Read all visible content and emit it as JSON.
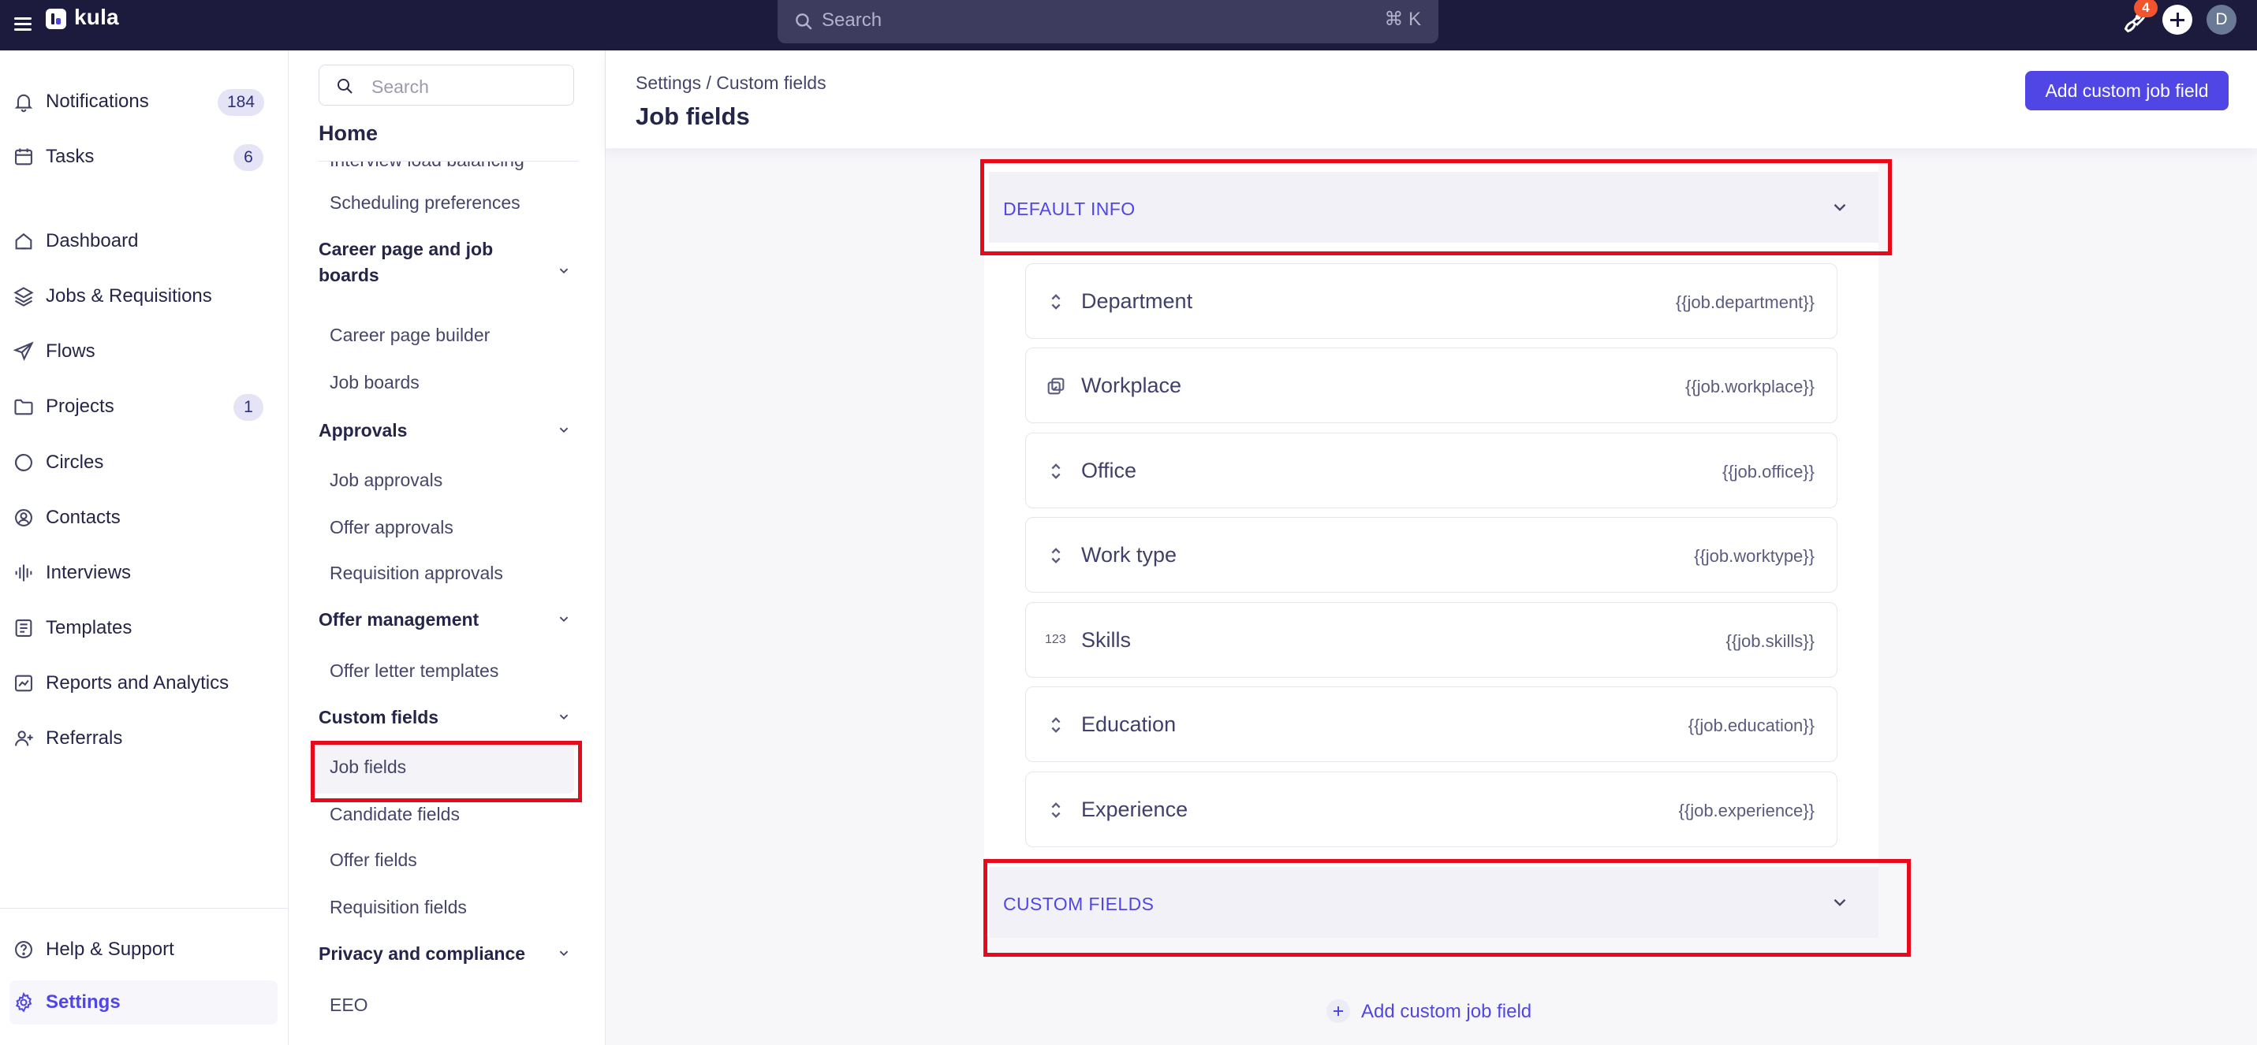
{
  "topbar": {
    "app_name": "kula",
    "search_placeholder": "Search",
    "search_shortcut": "⌘ K",
    "notification_badge": "4",
    "user_initial": "D"
  },
  "leftnav": {
    "items": [
      {
        "label": "Notifications",
        "count": "184",
        "icon": "bell-icon"
      },
      {
        "label": "Tasks",
        "count": "6",
        "icon": "calendar-icon"
      },
      {
        "label": "Dashboard",
        "icon": "home-icon"
      },
      {
        "label": "Jobs & Requisitions",
        "icon": "layers-icon"
      },
      {
        "label": "Flows",
        "icon": "send-icon"
      },
      {
        "label": "Projects",
        "count": "1",
        "icon": "folder-icon"
      },
      {
        "label": "Circles",
        "icon": "circles-icon"
      },
      {
        "label": "Contacts",
        "icon": "contact-icon"
      },
      {
        "label": "Interviews",
        "icon": "audio-wave-icon"
      },
      {
        "label": "Templates",
        "icon": "document-icon"
      },
      {
        "label": "Reports and Analytics",
        "icon": "chart-icon"
      },
      {
        "label": "Referrals",
        "icon": "user-plus-icon"
      }
    ],
    "bottom": [
      {
        "label": "Help & Support",
        "icon": "help-icon"
      },
      {
        "label": "Settings",
        "icon": "gear-icon",
        "active": true
      }
    ]
  },
  "subnav": {
    "search_placeholder": "Search",
    "home_label": "Home",
    "items": {
      "partial": "Interview load balancing",
      "scheduling": "Scheduling preferences",
      "career_group": "Career page and job boards",
      "career_builder": "Career page builder",
      "job_boards": "Job boards",
      "approvals_group": "Approvals",
      "job_approvals": "Job approvals",
      "offer_approvals": "Offer approvals",
      "requisition_approvals": "Requisition approvals",
      "offer_group": "Offer management",
      "offer_letter": "Offer letter templates",
      "custom_group": "Custom fields",
      "job_fields": "Job fields",
      "candidate_fields": "Candidate fields",
      "offer_fields": "Offer fields",
      "requisition_fields": "Requisition fields",
      "privacy_group": "Privacy and compliance",
      "eeo": "EEO"
    }
  },
  "main": {
    "breadcrumb": "Settings / Custom fields",
    "title": "Job fields",
    "add_button": "Add custom job field",
    "default_section": "DEFAULT INFO",
    "custom_section": "CUSTOM FIELDS",
    "fields": [
      {
        "name": "Department",
        "token": "{{job.department}}",
        "icon": "select-icon"
      },
      {
        "name": "Workplace",
        "token": "{{job.workplace}}",
        "icon": "multi-select-icon"
      },
      {
        "name": "Office",
        "token": "{{job.office}}",
        "icon": "select-icon"
      },
      {
        "name": "Work type",
        "token": "{{job.worktype}}",
        "icon": "select-icon"
      },
      {
        "name": "Skills",
        "token": "{{job.skills}}",
        "icon": "number-icon",
        "icon_text": "123"
      },
      {
        "name": "Education",
        "token": "{{job.education}}",
        "icon": "select-icon"
      },
      {
        "name": "Experience",
        "token": "{{job.experience}}",
        "icon": "select-icon"
      }
    ],
    "add_link": "Add custom job field"
  },
  "colors": {
    "accent": "#5046e5",
    "topbar": "#1c1b3e",
    "highlight": "#e8091b",
    "badge": "#f2542d"
  }
}
